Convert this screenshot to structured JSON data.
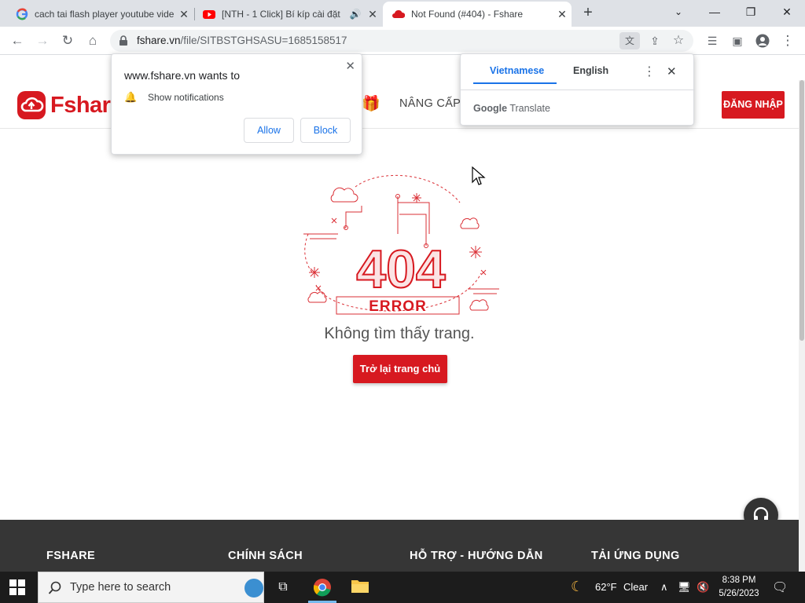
{
  "tabs": [
    {
      "title": "cach tai flash player youtube vide",
      "icon": "google-icon"
    },
    {
      "title": "[NTH - 1 Click] Bí kíp cài đặt",
      "icon": "youtube-icon"
    },
    {
      "title": "Not Found (#404) - Fshare",
      "icon": "fshare-icon"
    }
  ],
  "address": {
    "host": "fshare.vn",
    "path": "/file/SITBSTGHSASU=1685158517"
  },
  "notification": {
    "heading": "www.fshare.vn wants to",
    "permission": "Show notifications",
    "allow": "Allow",
    "block": "Block"
  },
  "translate": {
    "source": "Vietnamese",
    "target": "English",
    "brand_google": "Google",
    "brand_product": "Translate"
  },
  "site": {
    "logo": "Fshare",
    "upgrade": "NÂNG CẤP",
    "login": "ĐĂNG NHẬP",
    "error_code": "404",
    "error_word": "ERROR",
    "not_found": "Không tìm thấy trang.",
    "home_button": "Trở lại trang chủ"
  },
  "footer": [
    "FSHARE",
    "CHÍNH SÁCH",
    "HỖ TRỢ - HƯỚNG DẪN",
    "TẢI ỨNG DỤNG"
  ],
  "taskbar": {
    "search_placeholder": "Type here to search",
    "weather": "62°F",
    "weather_desc": "Clear",
    "time": "8:38 PM",
    "date": "5/26/2023"
  },
  "colors": {
    "brand": "#d71920",
    "accent": "#1a73e8",
    "footer": "#363636"
  }
}
